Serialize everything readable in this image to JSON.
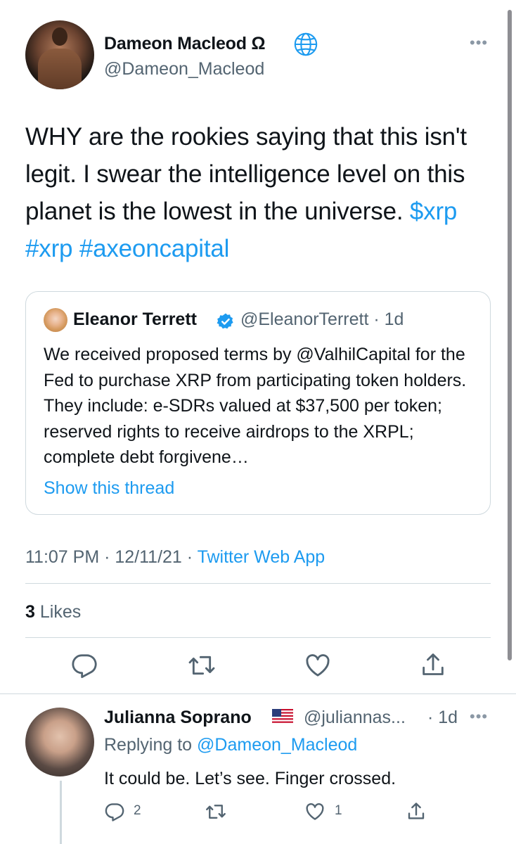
{
  "tweet": {
    "author_name": "Dameon Macleod Ω",
    "author_handle": "@Dameon_Macleod",
    "text_plain": "WHY are the rookies saying that this isn't legit. I swear the intelligence level on this planet is the lowest in the universe.",
    "hashtags": [
      "$xrp",
      "#xrp",
      "#axeoncapital"
    ],
    "time": "11:07 PM",
    "date": "12/11/21",
    "client": "Twitter Web App",
    "likes_count": "3",
    "likes_label": "Likes"
  },
  "quote": {
    "author_name": "Eleanor Terrett",
    "author_handle": "@EleanorTerrett",
    "age": "1d",
    "text": "We received proposed terms by @ValhilCapital for the Fed to purchase XRP from participating token holders. They include: e-SDRs valued at $37,500 per token; reserved rights to receive airdrops to the XRPL; complete debt forgivene…",
    "show_thread": "Show this thread"
  },
  "reply": {
    "author_name": "Julianna Soprano",
    "author_handle": "@juliannas...",
    "age": "1d",
    "replying_prefix": "Replying to",
    "replying_to": "@Dameon_Macleod",
    "text": "It could be. Let’s see. Finger crossed.",
    "reply_count": "2",
    "like_count": "1"
  },
  "icons": [
    "globe-icon",
    "verified-badge-icon",
    "reply-icon",
    "retweet-icon",
    "like-icon",
    "share-icon",
    "more-icon",
    "us-flag-icon"
  ],
  "colors": {
    "link": "#1d9bf0",
    "secondary": "#536471",
    "border": "#cfd9de"
  }
}
